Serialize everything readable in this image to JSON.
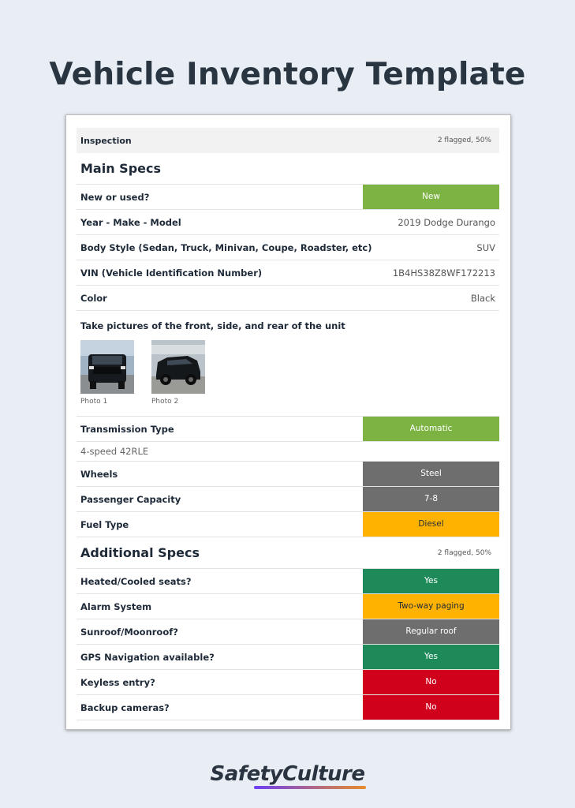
{
  "page": {
    "title": "Vehicle Inventory Template"
  },
  "inspection": {
    "label": "Inspection",
    "flag_summary": "2 flagged, 50%"
  },
  "main_specs": {
    "title": "Main Specs",
    "rows": [
      {
        "label": "New or used?",
        "value": "New",
        "kind": "pill",
        "color": "#7cb342"
      },
      {
        "label": "Year - Make - Model",
        "value": "2019 Dodge Durango",
        "kind": "text"
      },
      {
        "label": "Body Style (Sedan, Truck, Minivan, Coupe, Roadster, etc)",
        "value": "SUV",
        "kind": "text"
      },
      {
        "label": "VIN (Vehicle Identification Number)",
        "value": "1B4HS38Z8WF172213",
        "kind": "text"
      },
      {
        "label": "Color",
        "value": "Black",
        "kind": "text"
      }
    ],
    "photos": {
      "label": "Take pictures of the front, side, and rear of the unit",
      "items": [
        {
          "caption": "Photo 1"
        },
        {
          "caption": "Photo 2"
        }
      ]
    },
    "transmission": {
      "label": "Transmission Type",
      "value": "Automatic",
      "color": "#7cb342",
      "note": "4-speed 42RLE"
    },
    "rows2": [
      {
        "label": "Wheels",
        "value": "Steel",
        "color": "#6e6e6e"
      },
      {
        "label": "Passenger Capacity",
        "value": "7-8",
        "color": "#6e6e6e"
      },
      {
        "label": "Fuel Type",
        "value": "Diesel",
        "color": "#ffb300"
      }
    ]
  },
  "additional_specs": {
    "title": "Additional Specs",
    "flag_summary": "2 flagged, 50%",
    "rows": [
      {
        "label": "Heated/Cooled seats?",
        "value": "Yes",
        "color": "#1e8a5a"
      },
      {
        "label": "Alarm System",
        "value": "Two-way paging",
        "color": "#ffb300"
      },
      {
        "label": "Sunroof/Moonroof?",
        "value": "Regular roof",
        "color": "#6e6e6e"
      },
      {
        "label": "GPS Navigation available?",
        "value": "Yes",
        "color": "#1e8a5a"
      },
      {
        "label": "Keyless entry?",
        "value": "No",
        "color": "#d0021b"
      },
      {
        "label": "Backup cameras?",
        "value": "No",
        "color": "#d0021b"
      }
    ]
  },
  "brand": {
    "logo_text": "SafetyCulture"
  }
}
